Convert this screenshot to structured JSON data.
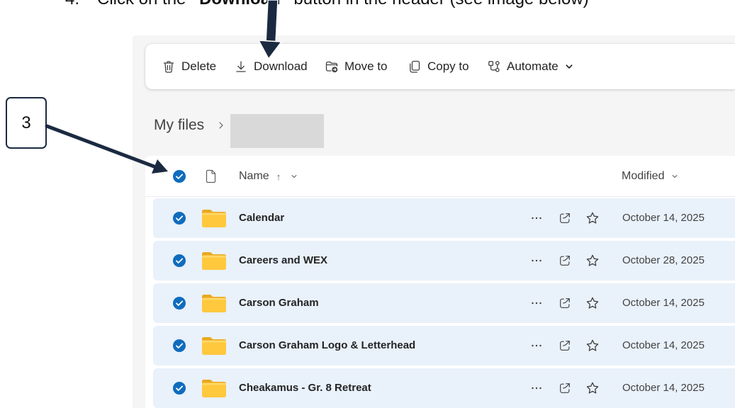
{
  "instruction": {
    "number": "4.",
    "before": "Click on the ",
    "emphasis": "“Download”",
    "after": " button in the header (see image below)"
  },
  "callout": {
    "label": "3"
  },
  "toolbar": {
    "items": [
      {
        "label": "Delete",
        "icon": "trash-icon"
      },
      {
        "label": "Download",
        "icon": "download-icon"
      },
      {
        "label": "Move to",
        "icon": "folder-move-icon"
      },
      {
        "label": "Copy to",
        "icon": "copy-icon"
      },
      {
        "label": "Automate",
        "icon": "flow-icon",
        "dropdown_icon": "chevron-down-icon"
      }
    ]
  },
  "breadcrumb": {
    "root": "My files",
    "separator_icon": "chevron-right-icon"
  },
  "list": {
    "header": {
      "all_selected": true,
      "type_icon": "document-icon",
      "name": "Name",
      "sort": "↑",
      "modified": "Modified"
    },
    "rows": [
      {
        "name": "Calendar",
        "modified": "October 14, 2025",
        "selected": true,
        "icon": "folder-icon"
      },
      {
        "name": "Careers and WEX",
        "modified": "October 28, 2025",
        "selected": true,
        "icon": "folder-icon"
      },
      {
        "name": "Carson Graham",
        "modified": "October 14, 2025",
        "selected": true,
        "icon": "folder-icon"
      },
      {
        "name": "Carson Graham Logo & Letterhead",
        "modified": "October 14, 2025",
        "selected": true,
        "icon": "folder-icon"
      },
      {
        "name": "Cheakamus - Gr. 8 Retreat",
        "modified": "October 14, 2025",
        "selected": true,
        "icon": "folder-icon"
      }
    ],
    "row_actions": [
      "more-icon",
      "share-icon",
      "star-icon"
    ]
  },
  "colors": {
    "accent": "#0f6cbd",
    "selected_row": "#e9f1fb",
    "folder": "#ffc83d",
    "annotation": "#1b2a41",
    "panel_background": "#f5f5f5",
    "redaction": "#d9d9d9"
  }
}
